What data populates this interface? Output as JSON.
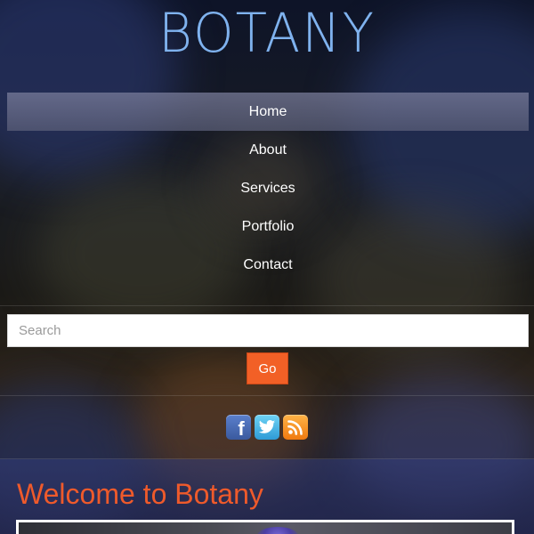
{
  "site": {
    "logo_text": "BOTANY"
  },
  "nav": {
    "items": [
      {
        "label": "Home",
        "active": true
      },
      {
        "label": "About",
        "active": false
      },
      {
        "label": "Services",
        "active": false
      },
      {
        "label": "Portfolio",
        "active": false
      },
      {
        "label": "Contact",
        "active": false
      }
    ]
  },
  "search": {
    "placeholder": "Search",
    "value": "",
    "button_label": "Go"
  },
  "social": {
    "icons": [
      "facebook-icon",
      "twitter-icon",
      "rss-icon"
    ]
  },
  "main": {
    "welcome_title": "Welcome to Botany"
  },
  "colors": {
    "logo": "#7fb2ee",
    "accent": "#f26026",
    "title": "#ef5a2b",
    "nav_active": "#6a6d88"
  }
}
